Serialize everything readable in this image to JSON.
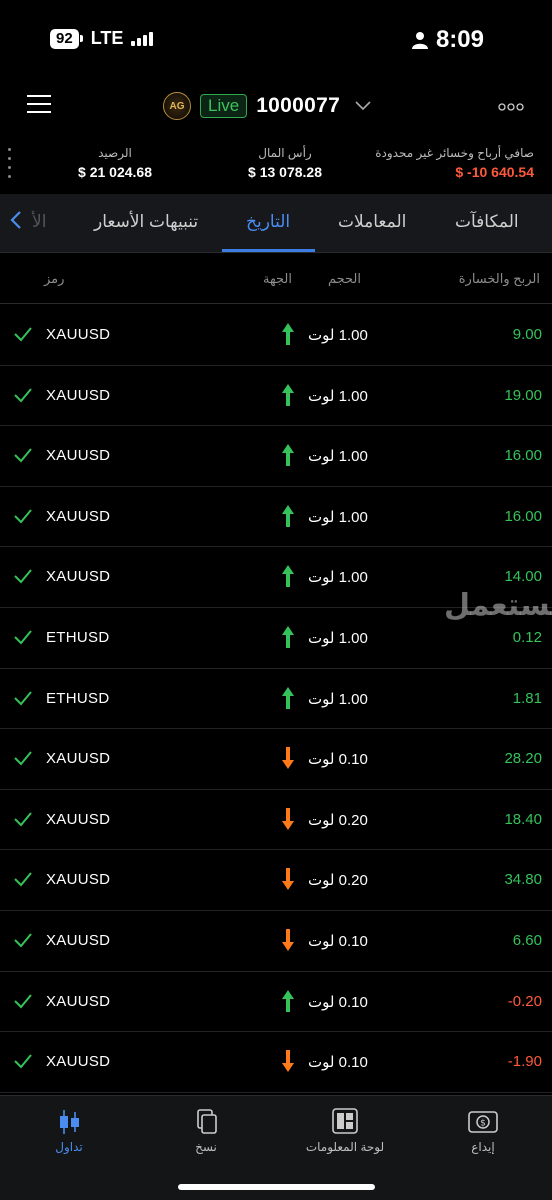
{
  "status_bar": {
    "battery": "92",
    "network": "LTE",
    "time": "8:09"
  },
  "header": {
    "live_label": "Live",
    "account_number": "1000077",
    "avatar_text": "AG"
  },
  "summary": {
    "balance_label": "الرصيد",
    "balance_value": "$ 21 024.68",
    "capital_label": "رأس المال",
    "capital_value": "$ 13 078.28",
    "pnl_label": "صافي أرباح وخسائر غير محدودة",
    "pnl_value": "$ -10 640.54"
  },
  "tabs": {
    "rewards": "المكافآت",
    "transactions": "المعاملات",
    "history": "التاريخ",
    "price_alerts": "تنبيهات الأسعار",
    "overflow": "الأ"
  },
  "columns": {
    "profit_loss": "الربح والخسارة",
    "volume": "الحجم",
    "direction": "الجهة",
    "symbol": "رمز"
  },
  "rows": [
    {
      "symbol": "XAUUSD",
      "direction": "up",
      "volume": "1.00 لوت",
      "profit": "9.00",
      "positive": true
    },
    {
      "symbol": "XAUUSD",
      "direction": "up",
      "volume": "1.00 لوت",
      "profit": "19.00",
      "positive": true
    },
    {
      "symbol": "XAUUSD",
      "direction": "up",
      "volume": "1.00 لوت",
      "profit": "16.00",
      "positive": true
    },
    {
      "symbol": "XAUUSD",
      "direction": "up",
      "volume": "1.00 لوت",
      "profit": "16.00",
      "positive": true
    },
    {
      "symbol": "XAUUSD",
      "direction": "up",
      "volume": "1.00 لوت",
      "profit": "14.00",
      "positive": true
    },
    {
      "symbol": "ETHUSD",
      "direction": "up",
      "volume": "1.00 لوت",
      "profit": "0.12",
      "positive": true
    },
    {
      "symbol": "ETHUSD",
      "direction": "up",
      "volume": "1.00 لوت",
      "profit": "1.81",
      "positive": true
    },
    {
      "symbol": "XAUUSD",
      "direction": "down",
      "volume": "0.10 لوت",
      "profit": "28.20",
      "positive": true
    },
    {
      "symbol": "XAUUSD",
      "direction": "down",
      "volume": "0.20 لوت",
      "profit": "18.40",
      "positive": true
    },
    {
      "symbol": "XAUUSD",
      "direction": "down",
      "volume": "0.20 لوت",
      "profit": "34.80",
      "positive": true
    },
    {
      "symbol": "XAUUSD",
      "direction": "down",
      "volume": "0.10 لوت",
      "profit": "6.60",
      "positive": true
    },
    {
      "symbol": "XAUUSD",
      "direction": "up",
      "volume": "0.10 لوت",
      "profit": "-0.20",
      "positive": false
    },
    {
      "symbol": "XAUUSD",
      "direction": "down",
      "volume": "0.10 لوت",
      "profit": "-1.90",
      "positive": false
    }
  ],
  "watermark": "مستعمل",
  "bottom_nav": {
    "trade": "تداول",
    "copy": "نسخ",
    "dashboard": "لوحة المعلومات",
    "deposit": "إيداع"
  },
  "colors": {
    "accent": "#4a8cf0",
    "profit": "#35c25a",
    "loss": "#ff5a3c",
    "up_arrow": "#35c25a",
    "down_arrow": "#ff7a1a"
  }
}
